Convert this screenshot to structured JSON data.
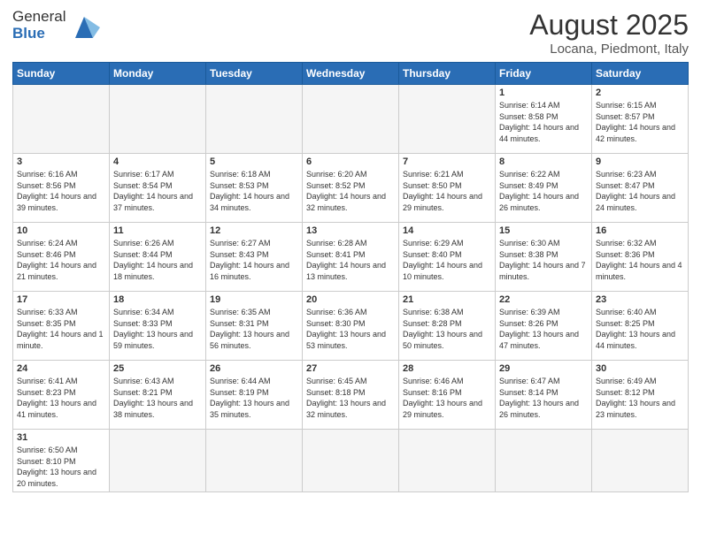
{
  "header": {
    "logo_general": "General",
    "logo_blue": "Blue",
    "month_year": "August 2025",
    "location": "Locana, Piedmont, Italy"
  },
  "days_of_week": [
    "Sunday",
    "Monday",
    "Tuesday",
    "Wednesday",
    "Thursday",
    "Friday",
    "Saturday"
  ],
  "weeks": [
    [
      {
        "day": "",
        "info": "",
        "empty": true
      },
      {
        "day": "",
        "info": "",
        "empty": true
      },
      {
        "day": "",
        "info": "",
        "empty": true
      },
      {
        "day": "",
        "info": "",
        "empty": true
      },
      {
        "day": "",
        "info": "",
        "empty": true
      },
      {
        "day": "1",
        "info": "Sunrise: 6:14 AM\nSunset: 8:58 PM\nDaylight: 14 hours and 44 minutes."
      },
      {
        "day": "2",
        "info": "Sunrise: 6:15 AM\nSunset: 8:57 PM\nDaylight: 14 hours and 42 minutes."
      }
    ],
    [
      {
        "day": "3",
        "info": "Sunrise: 6:16 AM\nSunset: 8:56 PM\nDaylight: 14 hours and 39 minutes."
      },
      {
        "day": "4",
        "info": "Sunrise: 6:17 AM\nSunset: 8:54 PM\nDaylight: 14 hours and 37 minutes."
      },
      {
        "day": "5",
        "info": "Sunrise: 6:18 AM\nSunset: 8:53 PM\nDaylight: 14 hours and 34 minutes."
      },
      {
        "day": "6",
        "info": "Sunrise: 6:20 AM\nSunset: 8:52 PM\nDaylight: 14 hours and 32 minutes."
      },
      {
        "day": "7",
        "info": "Sunrise: 6:21 AM\nSunset: 8:50 PM\nDaylight: 14 hours and 29 minutes."
      },
      {
        "day": "8",
        "info": "Sunrise: 6:22 AM\nSunset: 8:49 PM\nDaylight: 14 hours and 26 minutes."
      },
      {
        "day": "9",
        "info": "Sunrise: 6:23 AM\nSunset: 8:47 PM\nDaylight: 14 hours and 24 minutes."
      }
    ],
    [
      {
        "day": "10",
        "info": "Sunrise: 6:24 AM\nSunset: 8:46 PM\nDaylight: 14 hours and 21 minutes."
      },
      {
        "day": "11",
        "info": "Sunrise: 6:26 AM\nSunset: 8:44 PM\nDaylight: 14 hours and 18 minutes."
      },
      {
        "day": "12",
        "info": "Sunrise: 6:27 AM\nSunset: 8:43 PM\nDaylight: 14 hours and 16 minutes."
      },
      {
        "day": "13",
        "info": "Sunrise: 6:28 AM\nSunset: 8:41 PM\nDaylight: 14 hours and 13 minutes."
      },
      {
        "day": "14",
        "info": "Sunrise: 6:29 AM\nSunset: 8:40 PM\nDaylight: 14 hours and 10 minutes."
      },
      {
        "day": "15",
        "info": "Sunrise: 6:30 AM\nSunset: 8:38 PM\nDaylight: 14 hours and 7 minutes."
      },
      {
        "day": "16",
        "info": "Sunrise: 6:32 AM\nSunset: 8:36 PM\nDaylight: 14 hours and 4 minutes."
      }
    ],
    [
      {
        "day": "17",
        "info": "Sunrise: 6:33 AM\nSunset: 8:35 PM\nDaylight: 14 hours and 1 minute."
      },
      {
        "day": "18",
        "info": "Sunrise: 6:34 AM\nSunset: 8:33 PM\nDaylight: 13 hours and 59 minutes."
      },
      {
        "day": "19",
        "info": "Sunrise: 6:35 AM\nSunset: 8:31 PM\nDaylight: 13 hours and 56 minutes."
      },
      {
        "day": "20",
        "info": "Sunrise: 6:36 AM\nSunset: 8:30 PM\nDaylight: 13 hours and 53 minutes."
      },
      {
        "day": "21",
        "info": "Sunrise: 6:38 AM\nSunset: 8:28 PM\nDaylight: 13 hours and 50 minutes."
      },
      {
        "day": "22",
        "info": "Sunrise: 6:39 AM\nSunset: 8:26 PM\nDaylight: 13 hours and 47 minutes."
      },
      {
        "day": "23",
        "info": "Sunrise: 6:40 AM\nSunset: 8:25 PM\nDaylight: 13 hours and 44 minutes."
      }
    ],
    [
      {
        "day": "24",
        "info": "Sunrise: 6:41 AM\nSunset: 8:23 PM\nDaylight: 13 hours and 41 minutes."
      },
      {
        "day": "25",
        "info": "Sunrise: 6:43 AM\nSunset: 8:21 PM\nDaylight: 13 hours and 38 minutes."
      },
      {
        "day": "26",
        "info": "Sunrise: 6:44 AM\nSunset: 8:19 PM\nDaylight: 13 hours and 35 minutes."
      },
      {
        "day": "27",
        "info": "Sunrise: 6:45 AM\nSunset: 8:18 PM\nDaylight: 13 hours and 32 minutes."
      },
      {
        "day": "28",
        "info": "Sunrise: 6:46 AM\nSunset: 8:16 PM\nDaylight: 13 hours and 29 minutes."
      },
      {
        "day": "29",
        "info": "Sunrise: 6:47 AM\nSunset: 8:14 PM\nDaylight: 13 hours and 26 minutes."
      },
      {
        "day": "30",
        "info": "Sunrise: 6:49 AM\nSunset: 8:12 PM\nDaylight: 13 hours and 23 minutes."
      }
    ],
    [
      {
        "day": "31",
        "info": "Sunrise: 6:50 AM\nSunset: 8:10 PM\nDaylight: 13 hours and 20 minutes."
      },
      {
        "day": "",
        "info": "",
        "empty": true
      },
      {
        "day": "",
        "info": "",
        "empty": true
      },
      {
        "day": "",
        "info": "",
        "empty": true
      },
      {
        "day": "",
        "info": "",
        "empty": true
      },
      {
        "day": "",
        "info": "",
        "empty": true
      },
      {
        "day": "",
        "info": "",
        "empty": true
      }
    ]
  ]
}
